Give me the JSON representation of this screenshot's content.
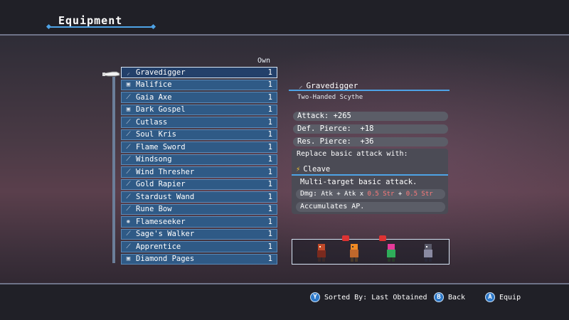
{
  "screen": {
    "title": "Equipment"
  },
  "list": {
    "own_header": "Own",
    "items": [
      {
        "icon": "scythe-icon",
        "glyph": "⸝",
        "name": "Gravedigger",
        "count": "1",
        "selected": true
      },
      {
        "icon": "tome-icon",
        "glyph": "▣",
        "name": "Malifice",
        "count": "1"
      },
      {
        "icon": "axe-icon",
        "glyph": "⟋",
        "name": "Gaia Axe",
        "count": "1"
      },
      {
        "icon": "book-icon",
        "glyph": "▣",
        "name": "Dark Gospel",
        "count": "1"
      },
      {
        "icon": "cutlass-icon",
        "glyph": "⟋",
        "name": "Cutlass",
        "count": "1"
      },
      {
        "icon": "dagger-icon",
        "glyph": "⟋",
        "name": "Soul Kris",
        "count": "1"
      },
      {
        "icon": "sword-icon",
        "glyph": "⟋",
        "name": "Flame Sword",
        "count": "1"
      },
      {
        "icon": "sword-icon",
        "glyph": "⟋",
        "name": "Windsong",
        "count": "1"
      },
      {
        "icon": "scythe-icon",
        "glyph": "⟋",
        "name": "Wind Thresher",
        "count": "1"
      },
      {
        "icon": "rapier-icon",
        "glyph": "⟋",
        "name": "Gold Rapier",
        "count": "1"
      },
      {
        "icon": "wand-icon",
        "glyph": "⟋",
        "name": "Stardust Wand",
        "count": "1"
      },
      {
        "icon": "bow-icon",
        "glyph": "⟋",
        "name": "Rune Bow",
        "count": "1"
      },
      {
        "icon": "flail-icon",
        "glyph": "✺",
        "name": "Flameseeker",
        "count": "1"
      },
      {
        "icon": "staff-icon",
        "glyph": "⟋",
        "name": "Sage's Walker",
        "count": "1"
      },
      {
        "icon": "wand-icon",
        "glyph": "⟋",
        "name": "Apprentice",
        "count": "1"
      },
      {
        "icon": "tome-icon",
        "glyph": "▣",
        "name": "Diamond Pages",
        "count": "1"
      }
    ]
  },
  "details": {
    "icon": "scythe-icon",
    "glyph": "⸝",
    "name": "Gravedigger",
    "type": "Two-Handed Scythe",
    "stats": [
      {
        "label": "Attack:",
        "value": "+265"
      },
      {
        "label": "Def. Pierce:",
        "value": "+18"
      },
      {
        "label": "Res. Pierce:",
        "value": "+36"
      }
    ],
    "replace_label": "Replace basic attack with:",
    "skill": {
      "icon": "cleave-icon",
      "glyph": "⚡",
      "name": "Cleave"
    },
    "description": "Multi-target basic attack.",
    "dmg": {
      "label": "Dmg:",
      "white": "Atk + Atk x ",
      "red1": "0.5 Str",
      "plus": " + ",
      "red2": "0.5 Str"
    },
    "note": "Accumulates AP."
  },
  "hints": {
    "sort": {
      "button": "Y",
      "label": "Sorted By: Last Obtained"
    },
    "back": {
      "button": "B",
      "label": "Back"
    },
    "equip": {
      "button": "A",
      "label": "Equip"
    }
  },
  "colors": {
    "accent": "#4ea3e6",
    "row": "#2f5a86",
    "button": "#2d78c8",
    "dmg_red": "#ff7a7a"
  }
}
